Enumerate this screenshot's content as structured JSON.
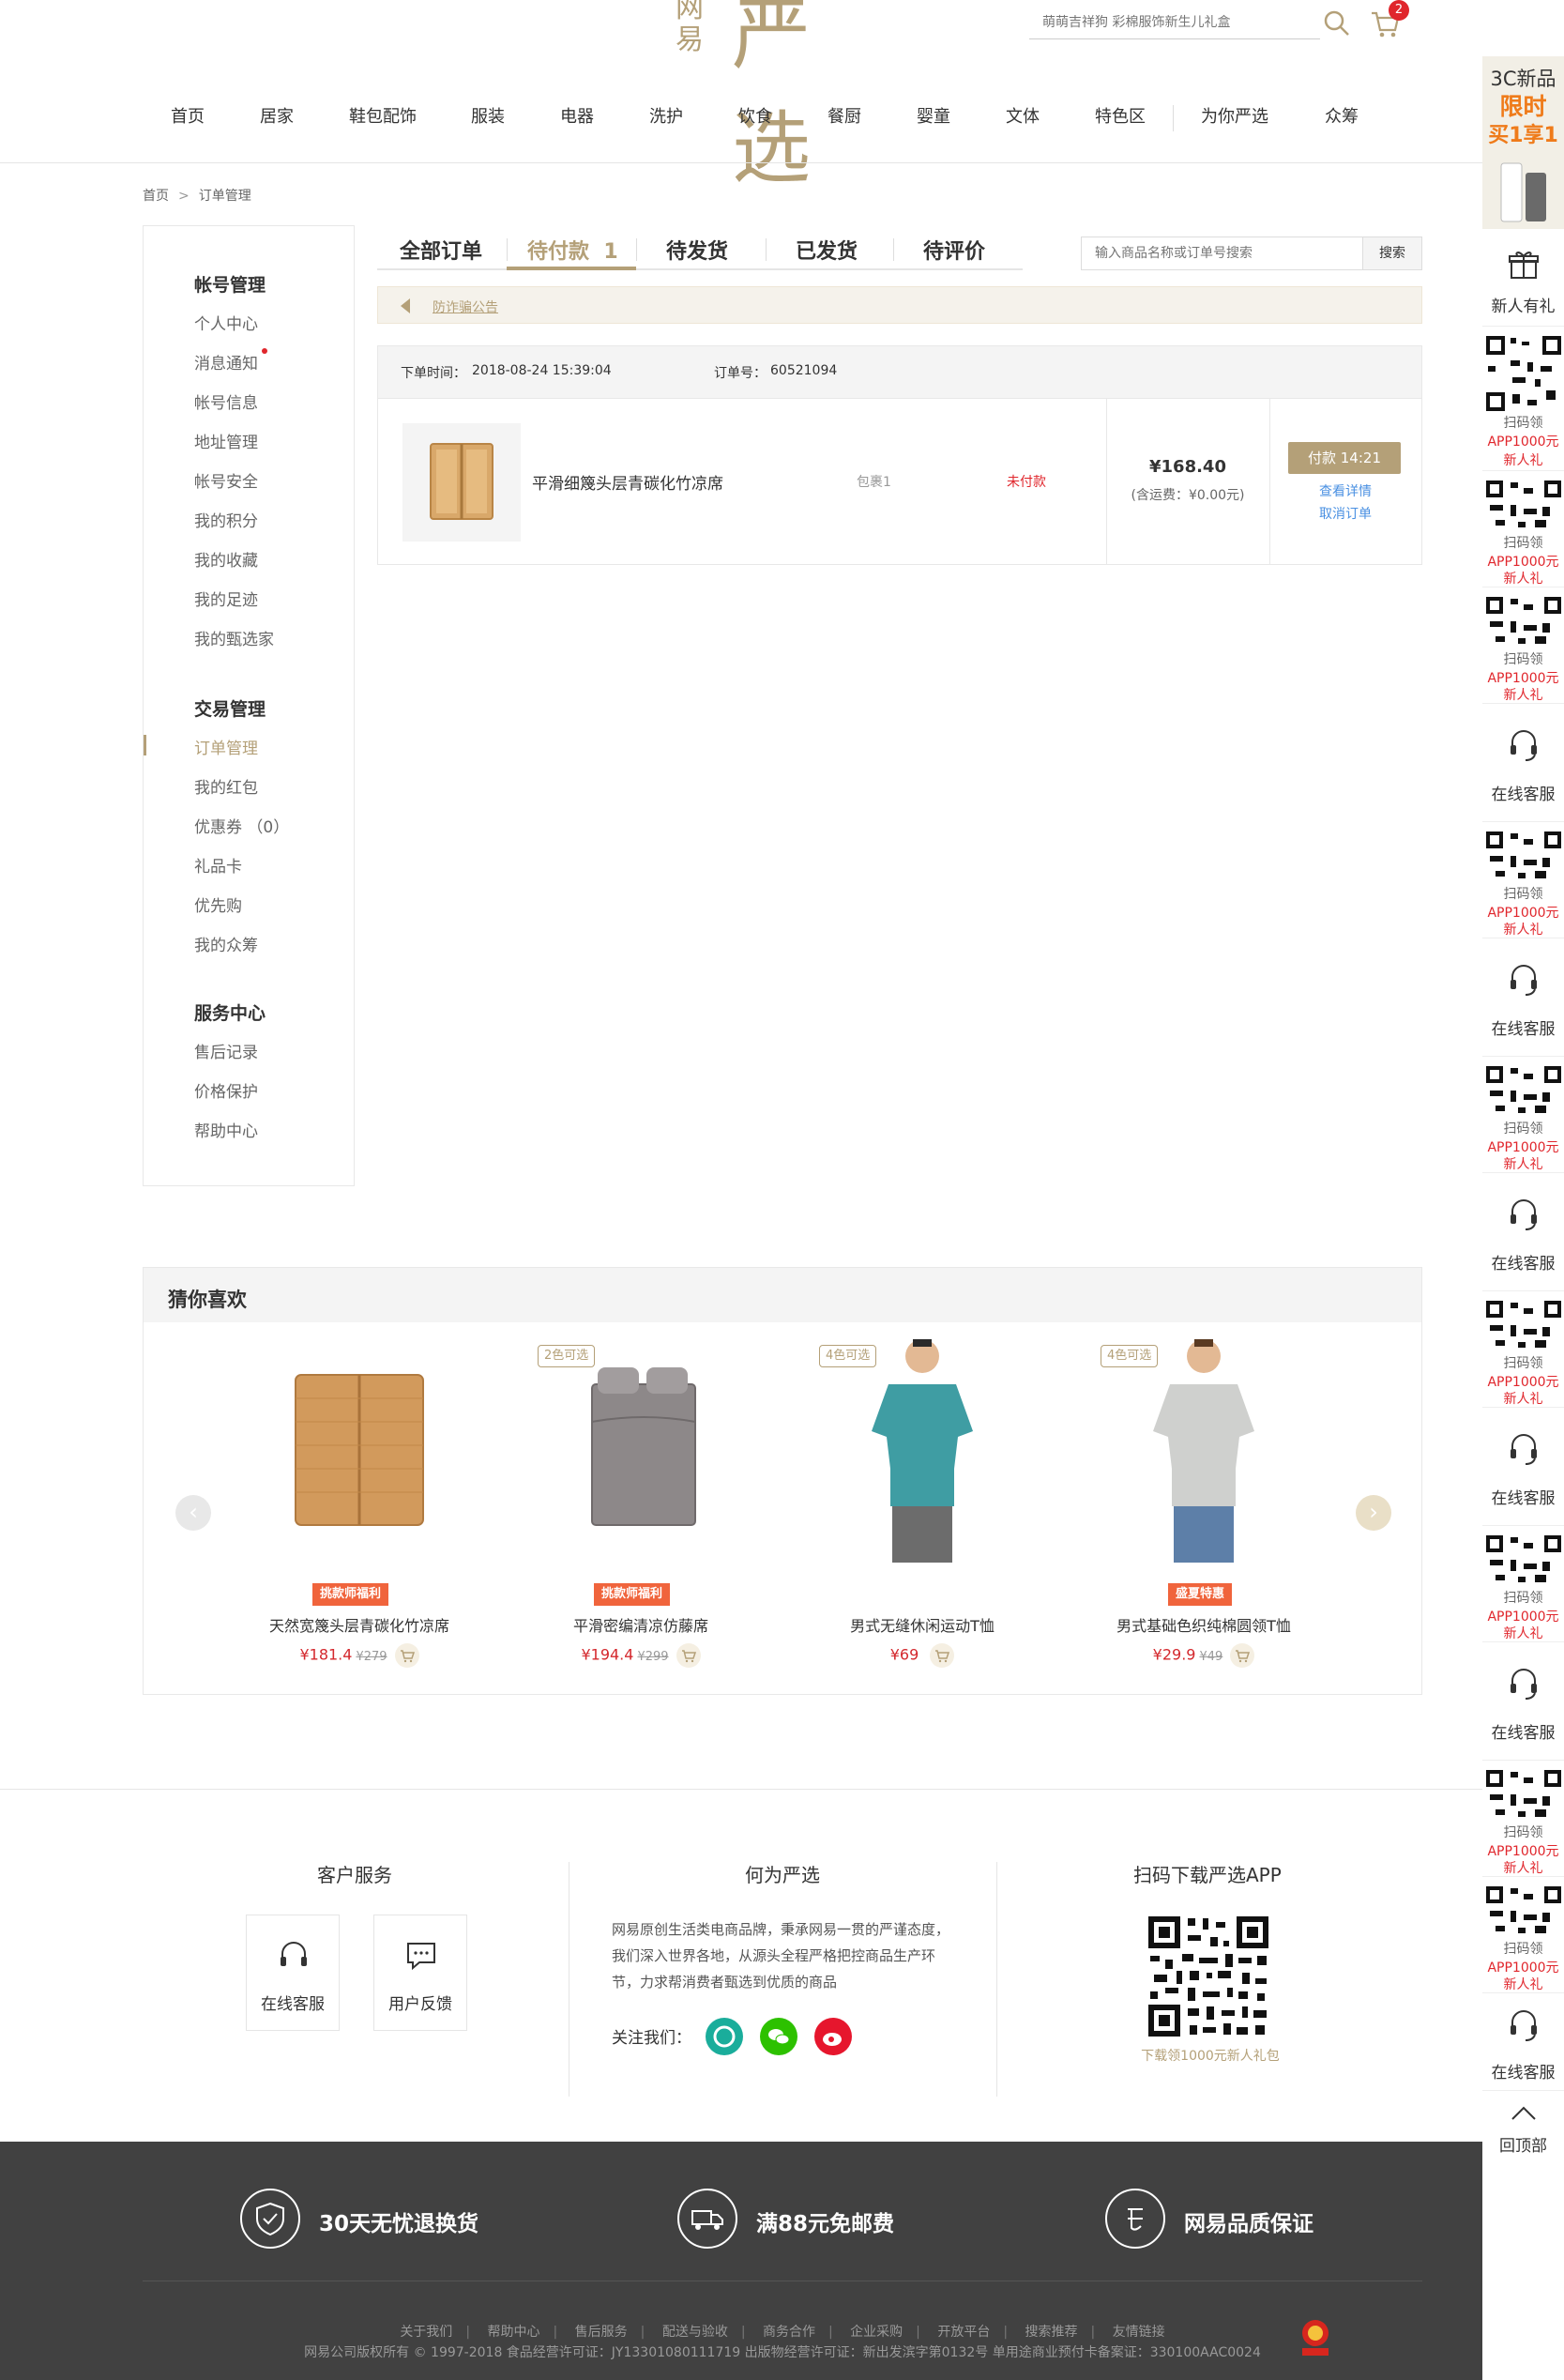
{
  "header": {
    "logo_small": "网易",
    "logo_big": "严选",
    "search_placeholder": "萌萌吉祥狗 彩棉服饰新生儿礼盒",
    "cart_count": "2"
  },
  "nav": [
    "首页",
    "居家",
    "鞋包配饰",
    "服装",
    "电器",
    "洗护",
    "饮食",
    "餐厨",
    "婴童",
    "文体",
    "特色区",
    "为你严选",
    "众筹"
  ],
  "breadcrumb": {
    "home": "首页",
    "sep": ">",
    "current": "订单管理"
  },
  "sidebar": {
    "account_title": "帐号管理",
    "account_items": [
      "个人中心",
      "消息通知",
      "帐号信息",
      "地址管理",
      "帐号安全",
      "我的积分",
      "我的收藏",
      "我的足迹",
      "我的甄选家"
    ],
    "trade_title": "交易管理",
    "trade_items": [
      "订单管理",
      "我的红包",
      "优惠券 （0）",
      "礼品卡",
      "优先购",
      "我的众筹"
    ],
    "service_title": "服务中心",
    "service_items": [
      "售后记录",
      "价格保护",
      "帮助中心"
    ]
  },
  "tabs": {
    "all": "全部订单",
    "pending_pay": "待付款",
    "pending_pay_count": "1",
    "pending_ship": "待发货",
    "shipped": "已发货",
    "pending_review": "待评价"
  },
  "order_search": {
    "placeholder": "输入商品名称或订单号搜索",
    "button": "搜索"
  },
  "notice": "防诈骗公告",
  "order": {
    "time_label": "下单时间：",
    "time": "2018-08-24 15:39:04",
    "no_label": "订单号：",
    "no": "60521094",
    "product_name": "平滑细篾头层青碳化竹凉席",
    "package": "包裹1",
    "status": "未付款",
    "price": "¥168.40",
    "shipping": "(含运费：¥0.00元)",
    "pay_button": "付款 14:21",
    "view_detail": "查看详情",
    "cancel": "取消订单"
  },
  "recommend": {
    "title": "猜你喜欢",
    "prev": "‹",
    "next": "›",
    "items": [
      {
        "tag": "",
        "badge": "挑款师福利",
        "name": "天然宽篾头层青碳化竹凉席",
        "price": "¥181.4",
        "orig": "¥279"
      },
      {
        "tag": "2色可选",
        "badge": "挑款师福利",
        "name": "平滑密编清凉仿藤席",
        "price": "¥194.4",
        "orig": "¥299"
      },
      {
        "tag": "4色可选",
        "badge": "",
        "name": "男式无缝休闲运动T恤",
        "price": "¥69",
        "orig": ""
      },
      {
        "tag": "4色可选",
        "badge": "盛夏特惠",
        "name": "男式基础色织纯棉圆领T恤",
        "price": "¥29.9",
        "orig": "¥49"
      }
    ]
  },
  "footer": {
    "service_title": "客户服务",
    "online_service": "在线客服",
    "feedback": "用户反馈",
    "about_title": "何为严选",
    "about_text": "网易原创生活类电商品牌，秉承网易一贯的严谨态度，我们深入世界各地，从源头全程严格把控商品生产环节，力求帮消费者甄选到优质的商品",
    "follow": "关注我们：",
    "app_title": "扫码下载严选APP",
    "app_caption": "下载领1000元新人礼包",
    "promises": [
      "30天无忧退换货",
      "满88元免邮费",
      "网易品质保证"
    ],
    "links": [
      "关于我们",
      "帮助中心",
      "售后服务",
      "配送与验收",
      "商务合作",
      "企业采购",
      "开放平台",
      "搜索推荐",
      "友情链接"
    ],
    "copyright": "网易公司版权所有 © 1997-2018   食品经营许可证：JY13301080111719 出版物经营许可证：新出发滨字第0132号 单用途商业预付卡备案证：330100AAC0024"
  },
  "rail": {
    "promo_line1": "3C新品",
    "promo_line2": "限时",
    "promo_line3": "买1享1",
    "gift": "新人有礼",
    "qr_l1": "扫码领",
    "qr_l2": "APP1000元",
    "qr_l3": "新人礼",
    "service": "在线客服",
    "top": "回顶部"
  },
  "colors": {
    "accent": "#b4a078",
    "red": "#e0262c",
    "dark_footer": "#414141"
  }
}
